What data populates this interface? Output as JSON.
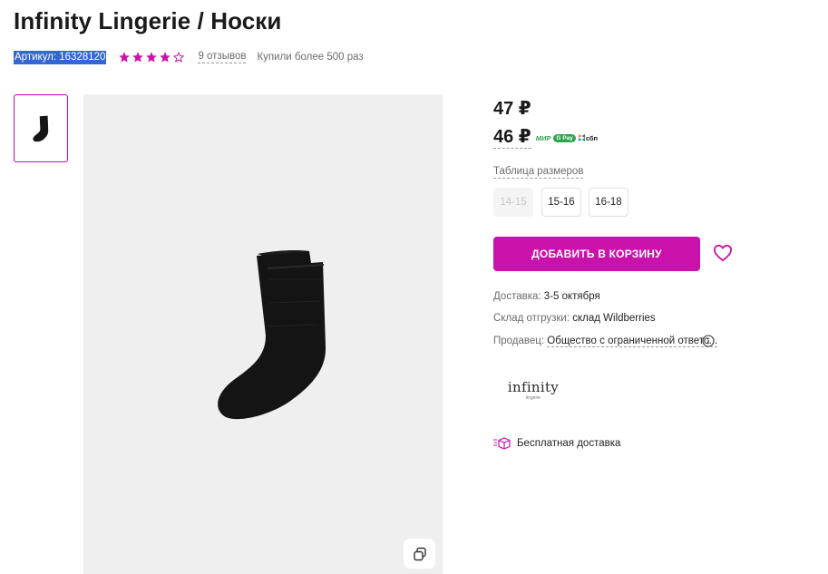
{
  "product": {
    "title": "Infinity Lingerie / Носки",
    "article": "Артикул: 16328120",
    "rating_stars": 4,
    "rating_max": 5,
    "reviews": "9 отзывов",
    "bought": "Купили более 500 раз"
  },
  "price": {
    "old": "47 ₽",
    "current": "46 ₽",
    "pay_mir": "МИР",
    "pay_pay": "G Pay",
    "pay_sbp": "сбп"
  },
  "sizes": {
    "label": "Таблица размеров",
    "options": [
      {
        "label": "14-15",
        "available": false
      },
      {
        "label": "15-16",
        "available": true
      },
      {
        "label": "16-18",
        "available": true
      }
    ]
  },
  "actions": {
    "add_to_cart": "ДОБАВИТЬ В КОРЗИНУ"
  },
  "details": {
    "delivery_label": "Доставка:",
    "delivery_value": "3-5 октября",
    "warehouse_label": "Склад отгрузки:",
    "warehouse_value": "склад Wildberries",
    "seller_label": "Продавец:",
    "seller_value": "Общество с ограниченной ответс..."
  },
  "brand": {
    "logo_text": "infinity",
    "logo_sub": "lingerie"
  },
  "free_delivery": "Бесплатная доставка",
  "colors": {
    "accent": "#cb11ab",
    "article_highlight": "#3366d6",
    "pay_green": "#2ea44f"
  }
}
